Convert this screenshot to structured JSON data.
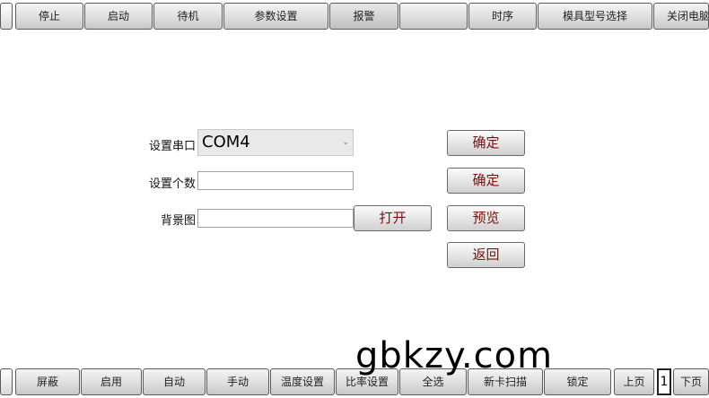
{
  "top_nav": {
    "items": [
      "停止",
      "启动",
      "待机",
      "参数设置",
      "报警",
      "",
      "时序",
      "模具型号选择",
      "关闭电脑"
    ]
  },
  "form": {
    "port_label": "设置串口",
    "port_value": "COM4",
    "count_label": "设置个数",
    "count_value": "",
    "bg_label": "背景图",
    "bg_value": "",
    "open_button": "打开",
    "confirm_port_button": "确定",
    "confirm_count_button": "确定",
    "preview_button": "预览",
    "back_button": "返回"
  },
  "bottom_nav": {
    "items": [
      "屏蔽",
      "启用",
      "自动",
      "手动",
      "温度设置",
      "比率设置",
      "全选",
      "新卡扫描",
      "锁定"
    ],
    "prev_page": "上页",
    "page_number": "1",
    "next_page": "下页"
  },
  "watermark": "gbkzy.com"
}
